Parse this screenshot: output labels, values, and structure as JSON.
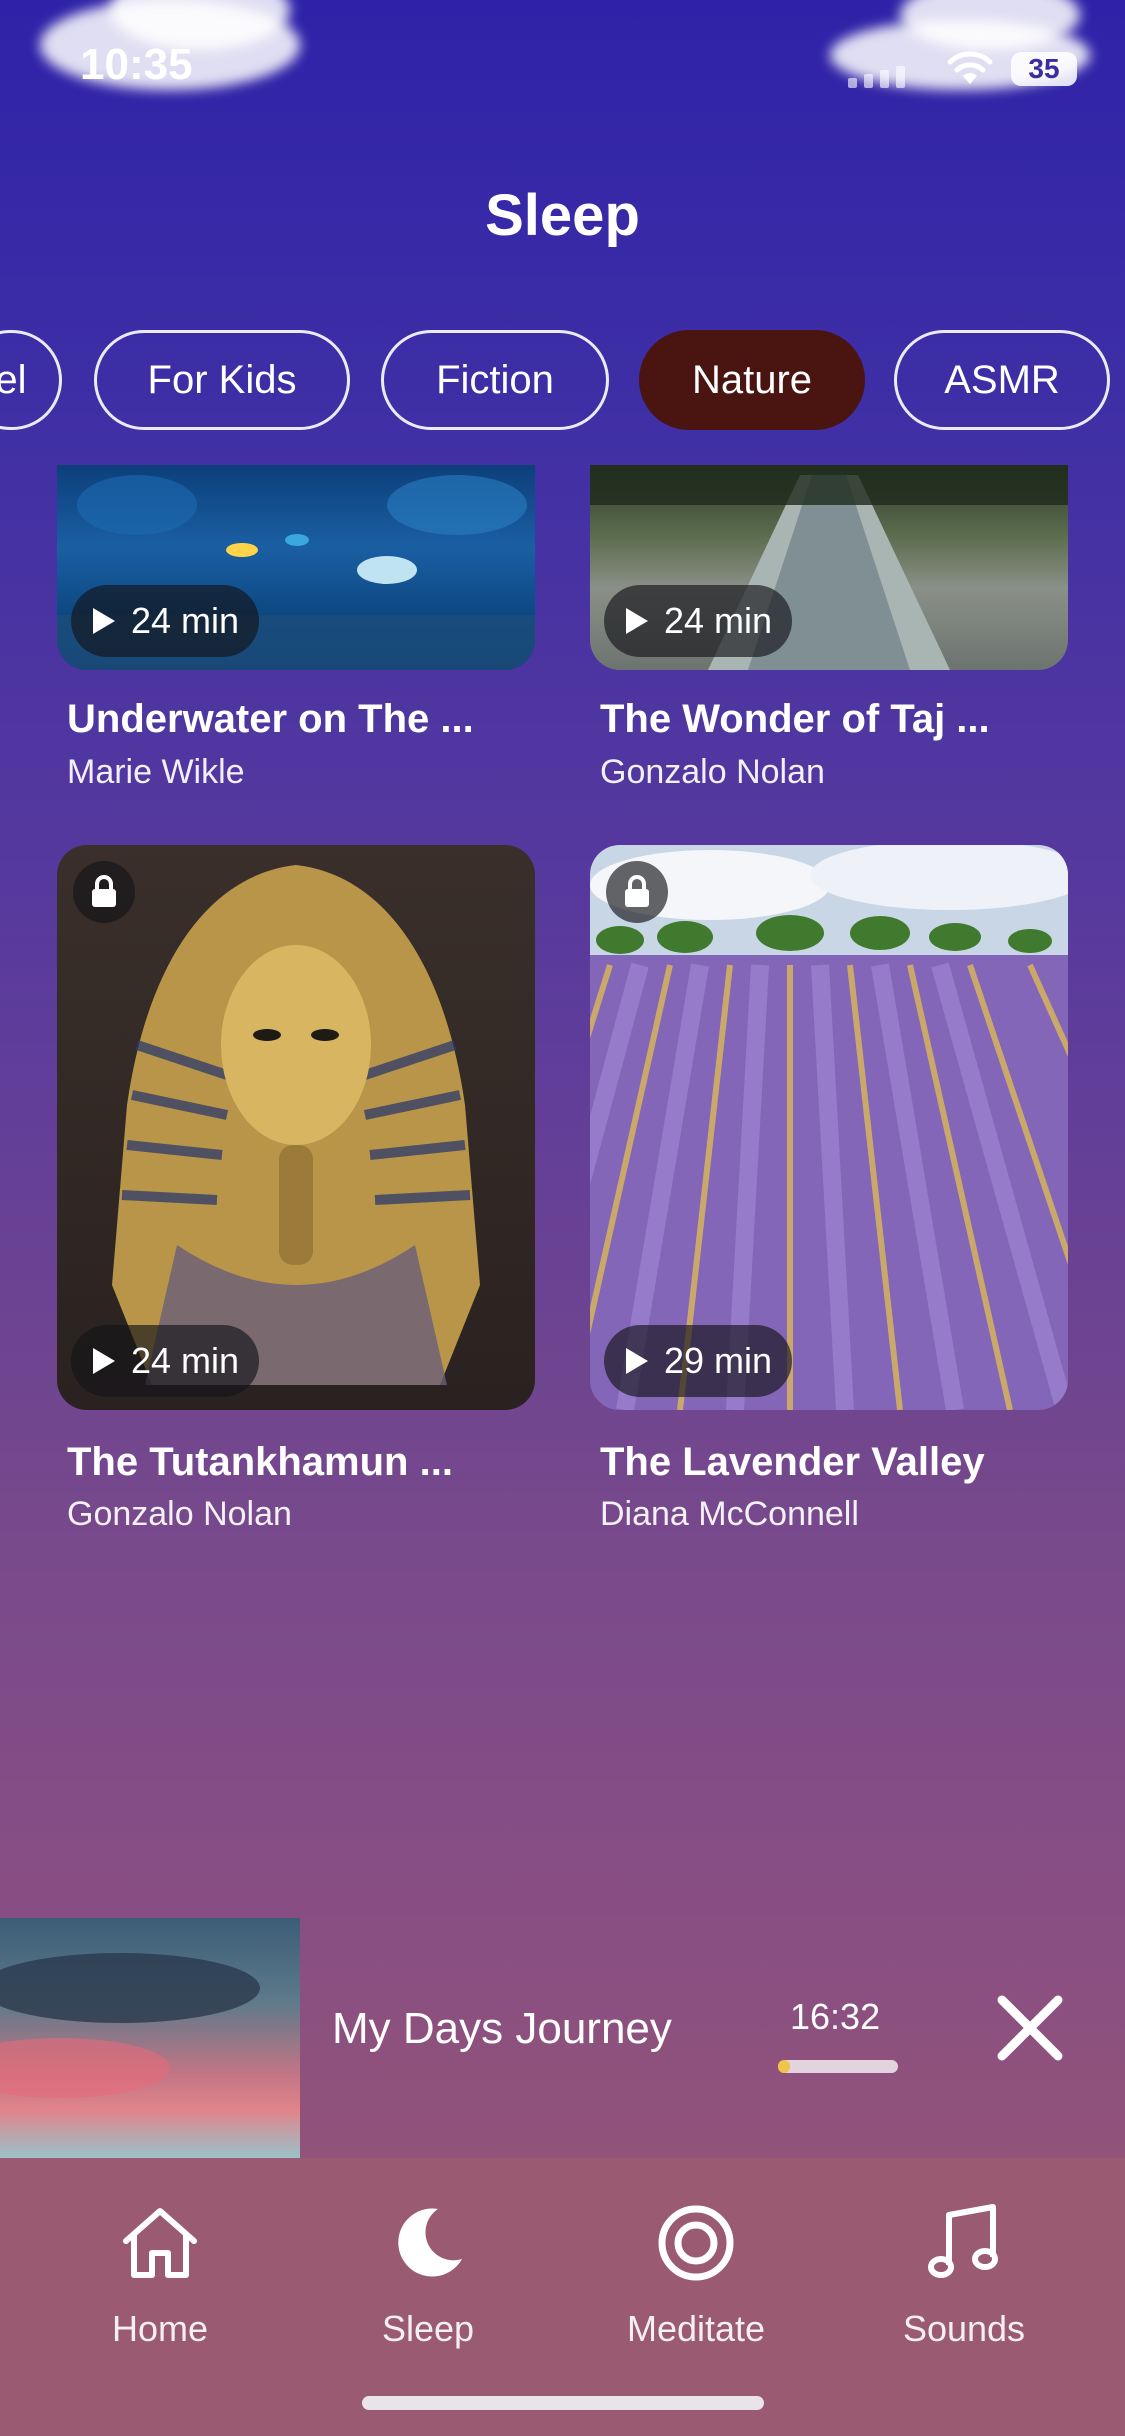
{
  "status_bar": {
    "time": "10:35",
    "battery": "35"
  },
  "header": {
    "title": "Sleep"
  },
  "chips": [
    {
      "label": "el"
    },
    {
      "label": "For Kids"
    },
    {
      "label": "Fiction"
    },
    {
      "label": "Nature",
      "active": true
    },
    {
      "label": "ASMR"
    }
  ],
  "cards": [
    {
      "title": "Underwater on The ...",
      "author": "Marie Wikle",
      "duration": "24 min",
      "locked": false
    },
    {
      "title": "The Wonder of Taj ...",
      "author": "Gonzalo Nolan",
      "duration": "24 min",
      "locked": false
    },
    {
      "title": "The Tutankhamun ...",
      "author": "Gonzalo Nolan",
      "duration": "24 min",
      "locked": true
    },
    {
      "title": "The Lavender Valley",
      "author": "Diana McConnell",
      "duration": "29 min",
      "locked": true
    }
  ],
  "player": {
    "title": "My Days Journey",
    "time": "16:32",
    "progress": 0.1
  },
  "tabs": [
    {
      "label": "Home",
      "icon": "home-icon"
    },
    {
      "label": "Sleep",
      "icon": "moon-icon"
    },
    {
      "label": "Meditate",
      "icon": "target-icon"
    },
    {
      "label": "Sounds",
      "icon": "music-note-icon"
    }
  ],
  "colors": {
    "active_chip": "#4a1410",
    "progress": "#f0c34a",
    "tabbar": "#9a5a72"
  }
}
